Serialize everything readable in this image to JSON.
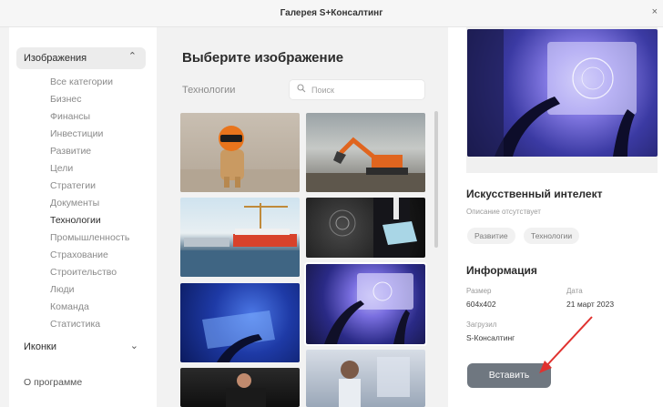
{
  "window": {
    "title": "Галерея S+Консалтинг",
    "close_glyph": "×"
  },
  "sidebar": {
    "group_label": "Изображения",
    "group_chevron": "⌃",
    "categories": [
      "Все категории",
      "Бизнес",
      "Финансы",
      "Инвестиции",
      "Развитие",
      "Цели",
      "Стратегии",
      "Документы",
      "Технологии",
      "Промышленность",
      "Страхование",
      "Строительство",
      "Люди",
      "Команда",
      "Статистика"
    ],
    "active_category": "Технологии",
    "icons_label": "Иконки",
    "icons_chevron": "⌄",
    "about_label": "О программе"
  },
  "main": {
    "heading": "Выберите изображение",
    "breadcrumb": "Технологии",
    "search": {
      "placeholder": "Поиск",
      "icon": "search-icon",
      "value": ""
    },
    "thumbnails": [
      {
        "name": "dog-helmet"
      },
      {
        "name": "excavator"
      },
      {
        "name": "cargo-ship"
      },
      {
        "name": "tablet-tech"
      },
      {
        "name": "ai-hand",
        "selected": true
      },
      {
        "name": "blue-screen"
      },
      {
        "name": "dark-hands"
      },
      {
        "name": "woman-screen"
      }
    ]
  },
  "details": {
    "name": "Искусственный интелект",
    "description": "Описание отсутствует",
    "tags": [
      "Развитие",
      "Технологии"
    ],
    "info_title": "Информация",
    "size_label": "Размер",
    "size_value": "604x402",
    "date_label": "Дата",
    "date_value": "21 март 2023",
    "uploaded_label": "Загрузил",
    "uploaded_value": "S-Консалтинг",
    "insert_label": "Вставить"
  },
  "colors": {
    "accent_arrow": "#e0322f",
    "button_bg": "#6f7780",
    "middle_bg": "#f2f2f2",
    "group_bg": "#ececec"
  }
}
